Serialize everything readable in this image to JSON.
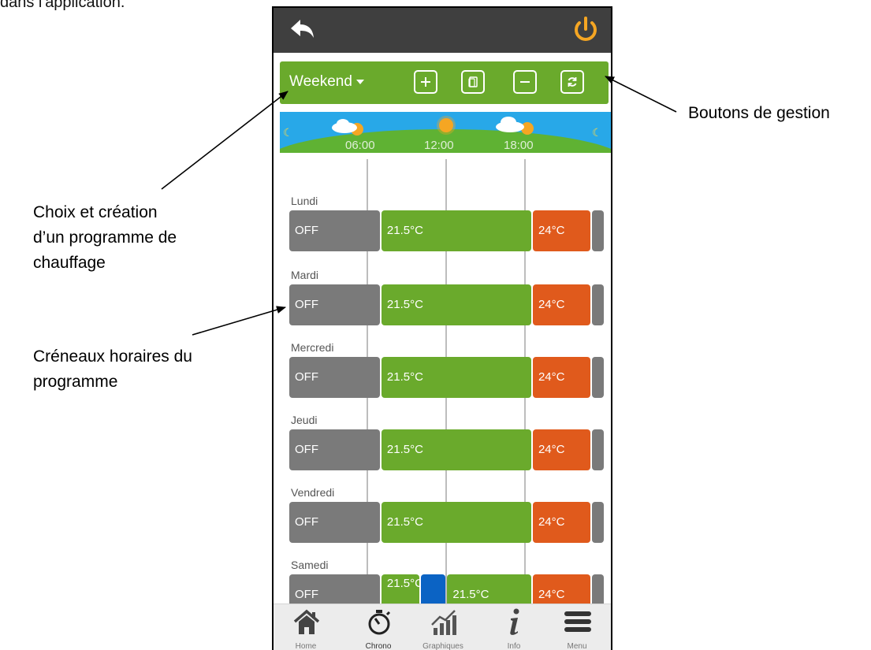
{
  "page_top_text": "dans l'application.",
  "annotations": {
    "management": "Boutons de gestion",
    "program_choice": [
      "Choix et création",
      "d’un programme de",
      "chauffage"
    ],
    "time_slots": [
      "Créneaux horaires du",
      "programme"
    ]
  },
  "app": {
    "topbar": {
      "back_icon": "back-arrow-icon",
      "power_icon": "power-icon",
      "power_color": "#f5a623"
    },
    "program_selector": {
      "label": "Weekend"
    },
    "management_buttons": [
      {
        "name": "add",
        "icon": "plus-icon"
      },
      {
        "name": "copy",
        "icon": "copy-icon"
      },
      {
        "name": "remove",
        "icon": "minus-icon"
      },
      {
        "name": "sync",
        "icon": "sync-icon"
      }
    ],
    "timeline": {
      "ticks": [
        "06:00",
        "12:00",
        "18:00"
      ]
    },
    "days": [
      {
        "name": "Lundi",
        "slots": [
          {
            "label": "OFF",
            "type": "off",
            "start": 0,
            "end": 7
          },
          {
            "label": "21.5°C",
            "type": "comfort",
            "start": 7,
            "end": 18.5
          },
          {
            "label": "24°C",
            "type": "hot",
            "start": 18.5,
            "end": 23
          },
          {
            "label": "",
            "type": "off",
            "start": 23,
            "end": 24
          }
        ]
      },
      {
        "name": "Mardi",
        "slots": [
          {
            "label": "OFF",
            "type": "off",
            "start": 0,
            "end": 7
          },
          {
            "label": "21.5°C",
            "type": "comfort",
            "start": 7,
            "end": 18.5
          },
          {
            "label": "24°C",
            "type": "hot",
            "start": 18.5,
            "end": 23
          },
          {
            "label": "",
            "type": "off",
            "start": 23,
            "end": 24
          }
        ]
      },
      {
        "name": "Mercredi",
        "slots": [
          {
            "label": "OFF",
            "type": "off",
            "start": 0,
            "end": 7
          },
          {
            "label": "21.5°C",
            "type": "comfort",
            "start": 7,
            "end": 18.5
          },
          {
            "label": "24°C",
            "type": "hot",
            "start": 18.5,
            "end": 23
          },
          {
            "label": "",
            "type": "off",
            "start": 23,
            "end": 24
          }
        ]
      },
      {
        "name": "Jeudi",
        "slots": [
          {
            "label": "OFF",
            "type": "off",
            "start": 0,
            "end": 7
          },
          {
            "label": "21.5°C",
            "type": "comfort",
            "start": 7,
            "end": 18.5
          },
          {
            "label": "24°C",
            "type": "hot",
            "start": 18.5,
            "end": 23
          },
          {
            "label": "",
            "type": "off",
            "start": 23,
            "end": 24
          }
        ]
      },
      {
        "name": "Vendredi",
        "slots": [
          {
            "label": "OFF",
            "type": "off",
            "start": 0,
            "end": 7
          },
          {
            "label": "21.5°C",
            "type": "comfort",
            "start": 7,
            "end": 18.5
          },
          {
            "label": "24°C",
            "type": "hot",
            "start": 18.5,
            "end": 23
          },
          {
            "label": "",
            "type": "off",
            "start": 23,
            "end": 24
          }
        ]
      },
      {
        "name": "Samedi",
        "slots": [
          {
            "label": "OFF",
            "type": "off",
            "start": 0,
            "end": 7
          },
          {
            "label": "21.5°C",
            "type": "comfort",
            "start": 7,
            "end": 10
          },
          {
            "label": "",
            "type": "eco",
            "start": 10,
            "end": 12
          },
          {
            "label": "21.5°C",
            "type": "comfort",
            "start": 12,
            "end": 18.5
          },
          {
            "label": "24°C",
            "type": "hot",
            "start": 18.5,
            "end": 23
          },
          {
            "label": "",
            "type": "off",
            "start": 23,
            "end": 24
          }
        ]
      }
    ],
    "bottom_nav": [
      {
        "label": "Home",
        "icon": "home-icon"
      },
      {
        "label": "Chrono",
        "icon": "stopwatch-icon",
        "active": true
      },
      {
        "label": "Graphiques",
        "icon": "chart-icon"
      },
      {
        "label": "Info",
        "icon": "info-icon"
      },
      {
        "label": "Menu",
        "icon": "hamburger-icon"
      }
    ],
    "colors": {
      "green": "#6aaa2c",
      "grey": "#7a7a7a",
      "orange": "#e05a1c",
      "blue": "#0b63c4",
      "topbar": "#3f3f3f"
    }
  }
}
